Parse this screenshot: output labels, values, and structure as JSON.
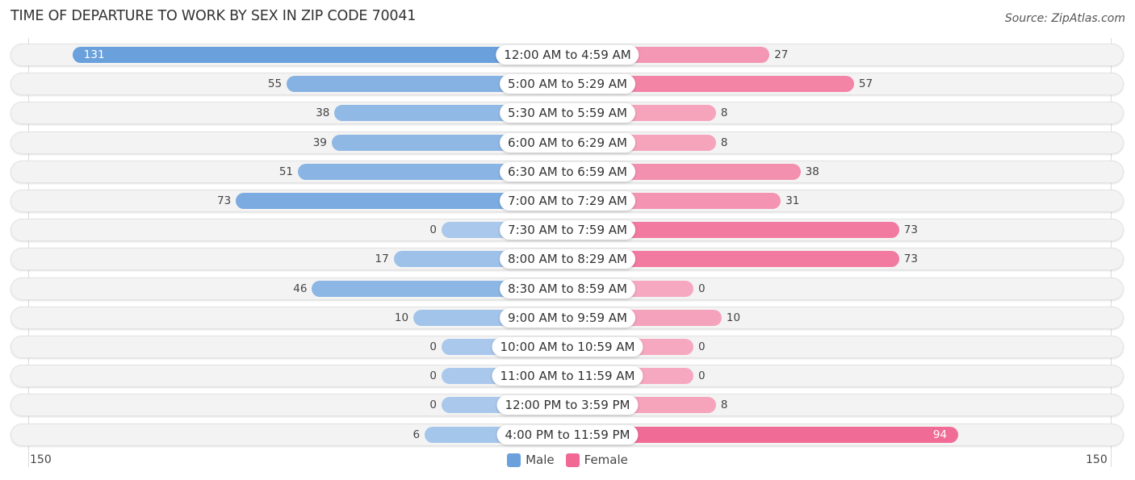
{
  "header": {
    "title": "TIME OF DEPARTURE TO WORK BY SEX IN ZIP CODE 70041",
    "source": "Source: ZipAtlas.com"
  },
  "colors": {
    "male": "#6aa0db",
    "male_light": "#a9c8ec",
    "female": "#f06893",
    "female_light": "#f6a8c0"
  },
  "chart_data": {
    "type": "bar",
    "orientation": "horizontal-diverging",
    "title": "TIME OF DEPARTURE TO WORK BY SEX IN ZIP CODE 70041",
    "categories": [
      "12:00 AM to 4:59 AM",
      "5:00 AM to 5:29 AM",
      "5:30 AM to 5:59 AM",
      "6:00 AM to 6:29 AM",
      "6:30 AM to 6:59 AM",
      "7:00 AM to 7:29 AM",
      "7:30 AM to 7:59 AM",
      "8:00 AM to 8:29 AM",
      "8:30 AM to 8:59 AM",
      "9:00 AM to 9:59 AM",
      "10:00 AM to 10:59 AM",
      "11:00 AM to 11:59 AM",
      "12:00 PM to 3:59 PM",
      "4:00 PM to 11:59 PM"
    ],
    "series": [
      {
        "name": "Male",
        "values": [
          131,
          55,
          38,
          39,
          51,
          73,
          0,
          17,
          46,
          10,
          0,
          0,
          0,
          6
        ]
      },
      {
        "name": "Female",
        "values": [
          27,
          57,
          8,
          8,
          38,
          31,
          73,
          73,
          0,
          10,
          0,
          0,
          8,
          94
        ]
      }
    ],
    "axis": {
      "left_tick": "150",
      "right_tick": "150",
      "range": [
        150,
        150
      ]
    },
    "legend": {
      "position": "bottom-center",
      "items": [
        "Male",
        "Female"
      ]
    },
    "grid": false
  }
}
